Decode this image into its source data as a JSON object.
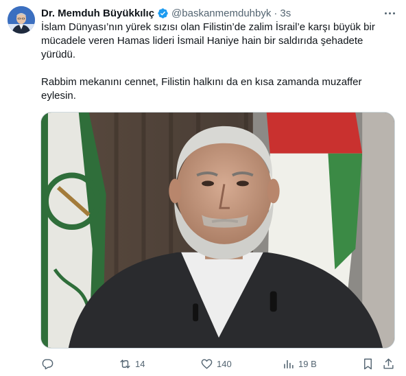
{
  "author": {
    "display_name": "Dr. Memduh Büyükkılıç",
    "handle": "@baskanmemduhbyk",
    "separator": "·",
    "time": "3s",
    "avatar_icon": "profile-avatar",
    "verified_icon": "verified-badge-icon",
    "verified_color": "#1d9bf0"
  },
  "tweet": {
    "paragraph_1": "İslam Dünyası’nın yürek sızısı olan Filistin’de zalim İsrail’e karşı büyük bir mücadele veren Hamas lideri İsmail Haniye hain bir saldırıda şehadete yürüdü.",
    "paragraph_2": "Rabbim mekanını cennet, Filistin halkını da en kısa zamanda muzaffer eylesin."
  },
  "media": {
    "type": "photo",
    "icon": "photo"
  },
  "actions": {
    "reply_count": "",
    "retweet_count": "14",
    "like_count": "140",
    "views_count": "19 B",
    "icons": [
      "reply-icon",
      "retweet-icon",
      "like-icon",
      "views-icon",
      "bookmark-icon",
      "share-icon"
    ]
  },
  "colors": {
    "text": "#0f1419",
    "secondary": "#536471",
    "border": "#cfd9de"
  }
}
